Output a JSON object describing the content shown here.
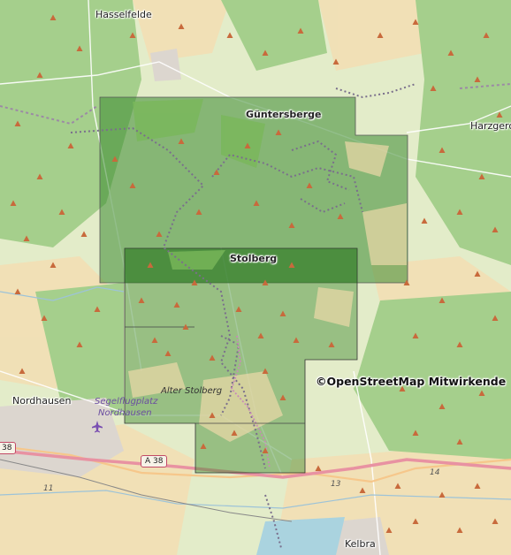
{
  "map": {
    "places": {
      "hasselfelde": "Hasselfelde",
      "guentersberge": "Güntersberge",
      "harzgerode": "Harzgero",
      "stolberg": "Stolberg",
      "alter_stolberg": "Alter Stolberg",
      "nordhausen": "Nordhausen",
      "segelflugplatz_1": "Segelflugplatz",
      "segelflugplatz_2": "Nordhausen",
      "kelbra": "Kelbra"
    },
    "roads": {
      "a38": "A 38",
      "shield_38": "38",
      "ref_11": "11",
      "ref_13": "13",
      "ref_14": "14"
    },
    "attribution": "©OpenStreetMap Mitwirkende",
    "colors": {
      "forest": "#a5cf8c",
      "forest_dark": "#6f9f59",
      "overlay_green": "#3b8a2f",
      "farmland": "#f3deb3",
      "motorway": "#e892a2",
      "trail": "#7a6f8c",
      "water": "#aad3df"
    },
    "icons": {
      "airfield": "airplane-icon",
      "peak": "peak-triangle-icon"
    }
  }
}
